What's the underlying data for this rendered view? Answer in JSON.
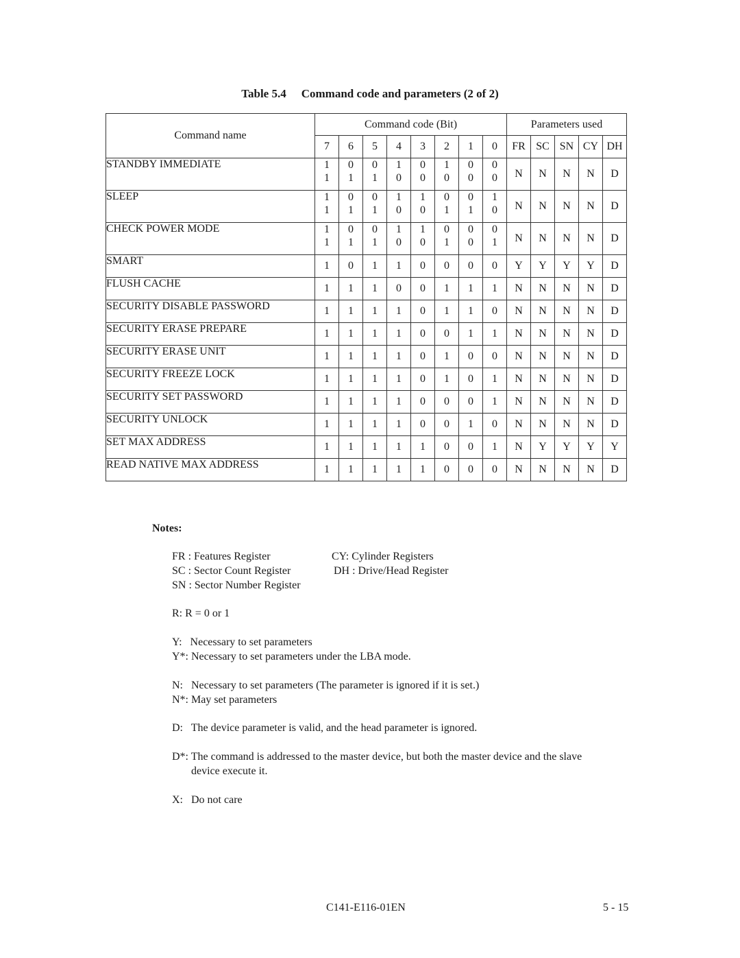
{
  "title": {
    "number": "Table 5.4",
    "caption": "Command code and parameters (2 of 2)"
  },
  "table": {
    "header": {
      "command_name": "Command name",
      "command_code_group": "Command code (Bit)",
      "parameters_group": "Parameters used",
      "bits": [
        "7",
        "6",
        "5",
        "4",
        "3",
        "2",
        "1",
        "0"
      ],
      "params": [
        "FR",
        "SC",
        "SN",
        "CY",
        "DH"
      ]
    },
    "rows": [
      {
        "name": "STANDBY IMMEDIATE",
        "bits": [
          "1",
          "0",
          "0",
          "1",
          "0",
          "1",
          "0",
          "0"
        ],
        "bits2": [
          "1",
          "1",
          "1",
          "0",
          "0",
          "0",
          "0",
          "0"
        ],
        "params": [
          "N",
          "N",
          "N",
          "N",
          "D"
        ]
      },
      {
        "name": "SLEEP",
        "bits": [
          "1",
          "0",
          "0",
          "1",
          "1",
          "0",
          "0",
          "1"
        ],
        "bits2": [
          "1",
          "1",
          "1",
          "0",
          "0",
          "1",
          "1",
          "0"
        ],
        "params": [
          "N",
          "N",
          "N",
          "N",
          "D"
        ]
      },
      {
        "name": "CHECK POWER MODE",
        "bits": [
          "1",
          "0",
          "0",
          "1",
          "1",
          "0",
          "0",
          "0"
        ],
        "bits2": [
          "1",
          "1",
          "1",
          "0",
          "0",
          "1",
          "0",
          "1"
        ],
        "params": [
          "N",
          "N",
          "N",
          "N",
          "D"
        ]
      },
      {
        "name": "SMART",
        "bits": [
          "1",
          "0",
          "1",
          "1",
          "0",
          "0",
          "0",
          "0"
        ],
        "params": [
          "Y",
          "Y",
          "Y",
          "Y",
          "D"
        ]
      },
      {
        "name": "FLUSH CACHE",
        "bits": [
          "1",
          "1",
          "1",
          "0",
          "0",
          "1",
          "1",
          "1"
        ],
        "params": [
          "N",
          "N",
          "N",
          "N",
          "D"
        ]
      },
      {
        "name": "SECURITY DISABLE PASSWORD",
        "bits": [
          "1",
          "1",
          "1",
          "1",
          "0",
          "1",
          "1",
          "0"
        ],
        "params": [
          "N",
          "N",
          "N",
          "N",
          "D"
        ]
      },
      {
        "name": "SECURITY ERASE PREPARE",
        "bits": [
          "1",
          "1",
          "1",
          "1",
          "0",
          "0",
          "1",
          "1"
        ],
        "params": [
          "N",
          "N",
          "N",
          "N",
          "D"
        ]
      },
      {
        "name": "SECURITY ERASE UNIT",
        "bits": [
          "1",
          "1",
          "1",
          "1",
          "0",
          "1",
          "0",
          "0"
        ],
        "params": [
          "N",
          "N",
          "N",
          "N",
          "D"
        ]
      },
      {
        "name": "SECURITY FREEZE LOCK",
        "bits": [
          "1",
          "1",
          "1",
          "1",
          "0",
          "1",
          "0",
          "1"
        ],
        "params": [
          "N",
          "N",
          "N",
          "N",
          "D"
        ]
      },
      {
        "name": "SECURITY SET PASSWORD",
        "bits": [
          "1",
          "1",
          "1",
          "1",
          "0",
          "0",
          "0",
          "1"
        ],
        "params": [
          "N",
          "N",
          "N",
          "N",
          "D"
        ]
      },
      {
        "name": "SECURITY UNLOCK",
        "bits": [
          "1",
          "1",
          "1",
          "1",
          "0",
          "0",
          "1",
          "0"
        ],
        "params": [
          "N",
          "N",
          "N",
          "N",
          "D"
        ]
      },
      {
        "name": "SET MAX ADDRESS",
        "bits": [
          "1",
          "1",
          "1",
          "1",
          "1",
          "0",
          "0",
          "1"
        ],
        "params": [
          "N",
          "Y",
          "Y",
          "Y",
          "Y"
        ]
      },
      {
        "name": "READ NATIVE MAX ADDRESS",
        "bits": [
          "1",
          "1",
          "1",
          "1",
          "1",
          "0",
          "0",
          "0"
        ],
        "params": [
          "N",
          "N",
          "N",
          "N",
          "D"
        ]
      }
    ]
  },
  "notes": {
    "label": "Notes:",
    "registers": {
      "fr": "FR : Features Register",
      "sc": "SC : Sector Count Register",
      "sn": "SN : Sector Number Register",
      "cy": "CY: Cylinder Registers",
      "dh": "DH : Drive/Head Register"
    },
    "r": "R: R = 0 or 1",
    "y": "Y:   Necessary to set parameters",
    "y_star": "Y*: Necessary to set parameters under the LBA mode.",
    "n": "N:   Necessary to set parameters (The parameter is ignored if it is set.)",
    "n_star": "N*: May set parameters",
    "d": "D:   The device parameter is valid, and the head parameter is ignored.",
    "d_star_line1": "D*: The command is addressed to the master device, but both the master device and the slave",
    "d_star_line2": "device execute it.",
    "x": "X:   Do not care"
  },
  "footer": {
    "doc_id": "C141-E116-01EN",
    "page": "5 - 15"
  }
}
